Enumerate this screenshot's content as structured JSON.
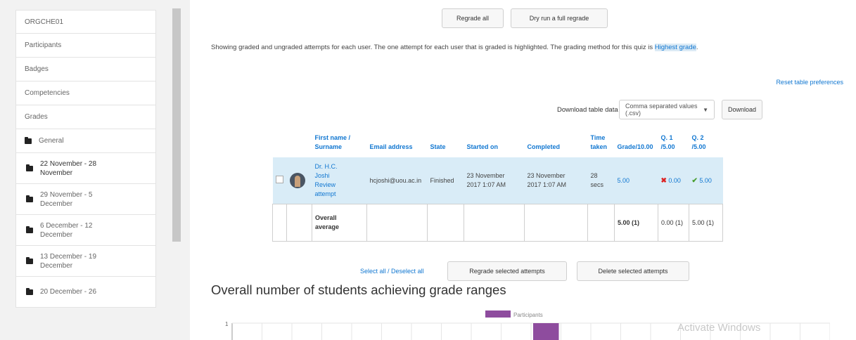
{
  "sidebar": {
    "items": [
      {
        "label": "ORGCHE01",
        "type": "single"
      },
      {
        "label": "Participants",
        "type": "single"
      },
      {
        "label": "Badges",
        "type": "single"
      },
      {
        "label": "Competencies",
        "type": "single"
      },
      {
        "label": "Grades",
        "type": "single"
      },
      {
        "label": "General",
        "type": "folder-single"
      },
      {
        "line1": "22 November - 28",
        "line2": "November",
        "type": "folder-double",
        "bold": true
      },
      {
        "line1": "29 November - 5",
        "line2": "December",
        "type": "folder-double"
      },
      {
        "line1": "6 December - 12",
        "line2": "December",
        "type": "folder-double"
      },
      {
        "line1": "13 December - 19",
        "line2": "December",
        "type": "folder-double"
      },
      {
        "line1": "20 December - 26",
        "line2": "",
        "type": "folder-double"
      }
    ]
  },
  "toolbar": {
    "regrade_all": "Regrade all",
    "dry_run": "Dry run a full regrade"
  },
  "info": {
    "text": "Showing graded and ungraded attempts for each user. The one attempt for each user that is graded is highlighted. The grading method for this quiz is ",
    "method": "Highest grade",
    "end": "."
  },
  "reset_link": "Reset table preferences",
  "download": {
    "label": "Download table data as",
    "format": "Comma separated values (.csv)",
    "button": "Download"
  },
  "table": {
    "headers": {
      "name1": "First name /",
      "name2": "Surname",
      "email": "Email address",
      "state": "State",
      "started": "Started on",
      "completed": "Completed",
      "time1": "Time",
      "time2": "taken",
      "grade": "Grade/10.00",
      "q1a": "Q. 1",
      "q1b": "/5.00",
      "q2a": "Q. 2",
      "q2b": "/5.00"
    },
    "row": {
      "name1": "Dr. H.C.",
      "name2": "Joshi",
      "review1": "Review",
      "review2": "attempt",
      "email": "hcjoshi@uou.ac.in",
      "state": "Finished",
      "started1": "23 November",
      "started2": "2017 1:07 AM",
      "completed1": "23 November",
      "completed2": "2017 1:07 AM",
      "time1": "28",
      "time2": "secs",
      "grade": "5.00",
      "q1": "0.00",
      "q2": "5.00"
    },
    "average": {
      "label1": "Overall",
      "label2": "average",
      "grade": "5.00 (1)",
      "q1": "0.00 (1)",
      "q2": "5.00 (1)"
    }
  },
  "selection": {
    "select_all": "Select all",
    "sep": " / ",
    "deselect_all": "Deselect all",
    "regrade_selected": "Regrade selected attempts",
    "delete_selected": "Delete selected attempts"
  },
  "chart_title": "Overall number of students achieving grade ranges",
  "chart_data": {
    "type": "bar",
    "legend": [
      "Participants"
    ],
    "legend_placement": "top-center",
    "y_tick_visible": [
      "1"
    ],
    "series": [
      {
        "name": "Participants",
        "color": "#8e4c9e",
        "highlighted_bin_index": 10
      }
    ],
    "bins_visible": 20,
    "grid": true
  },
  "watermark": "Activate Windows",
  "colors": {
    "link": "#1177d1",
    "highlight_row": "#d9ecf7",
    "bar": "#8e4c9e",
    "incorrect": "#dd2222",
    "correct": "#4a9f32"
  }
}
